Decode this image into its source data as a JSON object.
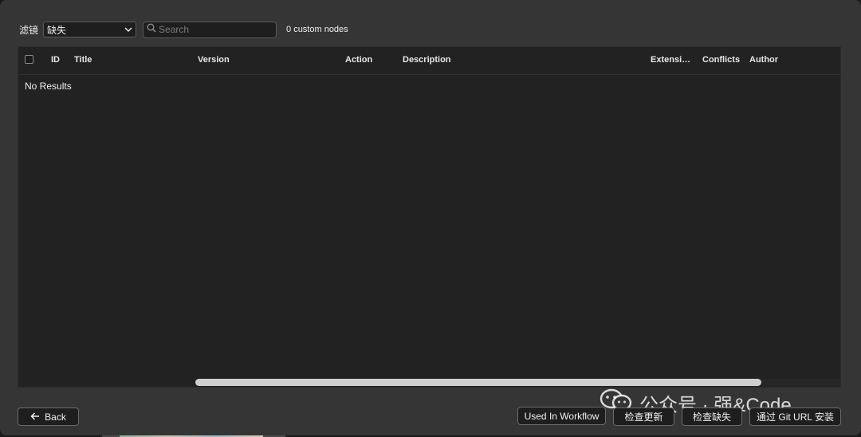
{
  "filter": {
    "label": "滤镜",
    "selected": "缺失"
  },
  "search": {
    "placeholder": "Search",
    "value": ""
  },
  "summary": {
    "count_text": "0 custom nodes"
  },
  "table": {
    "columns": [
      "ID",
      "Title",
      "Version",
      "Action",
      "Description",
      "Extensi…",
      "Conflicts",
      "Author"
    ],
    "empty_text": "No Results"
  },
  "buttons": {
    "back": "Back",
    "used_in_workflow": "Used In Workflow",
    "check_update": "检查更新",
    "check_missing": "检查缺失",
    "install_git_url": "通过 Git URL 安装"
  },
  "watermark": {
    "text": "公众号 · 强&Code"
  },
  "icons": {
    "search": "search-icon",
    "dropdown": "chevron-down-icon",
    "back": "arrow-left-icon",
    "wechat": "wechat-icon"
  }
}
